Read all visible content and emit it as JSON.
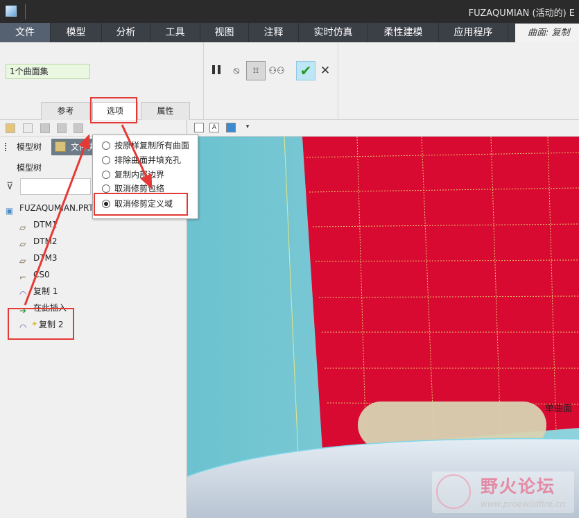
{
  "window": {
    "title": "FUZAQUMIAN (活动的) E"
  },
  "menu": {
    "tabs": [
      {
        "label": "文件"
      },
      {
        "label": "模型"
      },
      {
        "label": "分析"
      },
      {
        "label": "工具"
      },
      {
        "label": "视图"
      },
      {
        "label": "注释"
      },
      {
        "label": "实时仿真"
      },
      {
        "label": "柔性建模"
      },
      {
        "label": "应用程序"
      }
    ],
    "context_tab": "曲面: 复制"
  },
  "ribbon": {
    "surface_collector": "1个曲面集",
    "dashboard_tabs": [
      {
        "label": "参考"
      },
      {
        "label": "选项"
      },
      {
        "label": "属性"
      }
    ],
    "icons": {
      "pause": "pause-icon",
      "stop": "no-entry-icon",
      "preview": "preview-icon",
      "glasses": "glasses-icon",
      "ok": "checkmark-icon",
      "cancel": "x-icon"
    },
    "glyphs": {
      "stop": "⦸",
      "preview": "⟟⟟",
      "glasses": "⚇⚇",
      "ok": "✔",
      "cancel": "✕"
    }
  },
  "options_panel": {
    "items": [
      {
        "label": "按原样复制所有曲面",
        "selected": false
      },
      {
        "label": "排除曲面并填充孔",
        "selected": false
      },
      {
        "label": "复制内部边界",
        "selected": false
      },
      {
        "label": "取消修剪包络",
        "selected": false
      },
      {
        "label": "取消修剪定义域",
        "selected": true
      }
    ]
  },
  "left_panel": {
    "tabs": {
      "model_tree": "模型树",
      "file_folder": "文件夹"
    },
    "tree_title": "模型树",
    "search_placeholder": "",
    "filter_glyph": "⊽",
    "tree": [
      {
        "label": "FUZAQUMIAN.PRT",
        "icon": "part-icon",
        "glyph": "▣"
      },
      {
        "label": "DTM1",
        "icon": "datum-plane-icon",
        "glyph": "▱"
      },
      {
        "label": "DTM2",
        "icon": "datum-plane-icon",
        "glyph": "▱"
      },
      {
        "label": "DTM3",
        "icon": "datum-plane-icon",
        "glyph": "▱"
      },
      {
        "label": "CS0",
        "icon": "coordinate-system-icon",
        "glyph": "⌐"
      },
      {
        "label": "复制 1",
        "icon": "copy-surface-icon",
        "glyph": "◠"
      },
      {
        "label": "在此插入",
        "icon": "insert-here-icon",
        "glyph": "➔"
      },
      {
        "label": "复制 2",
        "icon": "copy-surface-icon",
        "glyph": "◠",
        "new_mark": "✳"
      }
    ]
  },
  "graphics_toolbar": {
    "text_button": "A"
  },
  "viewport": {
    "tooltip": "单曲面"
  },
  "colors": {
    "selected_surface": "#d80a32",
    "reference_surface": "#7fd0da",
    "highlight": "#e53935",
    "accept_green": "#1f9a27"
  },
  "watermark": {
    "title": "野火论坛",
    "url": "www.proewildfire.cn"
  }
}
